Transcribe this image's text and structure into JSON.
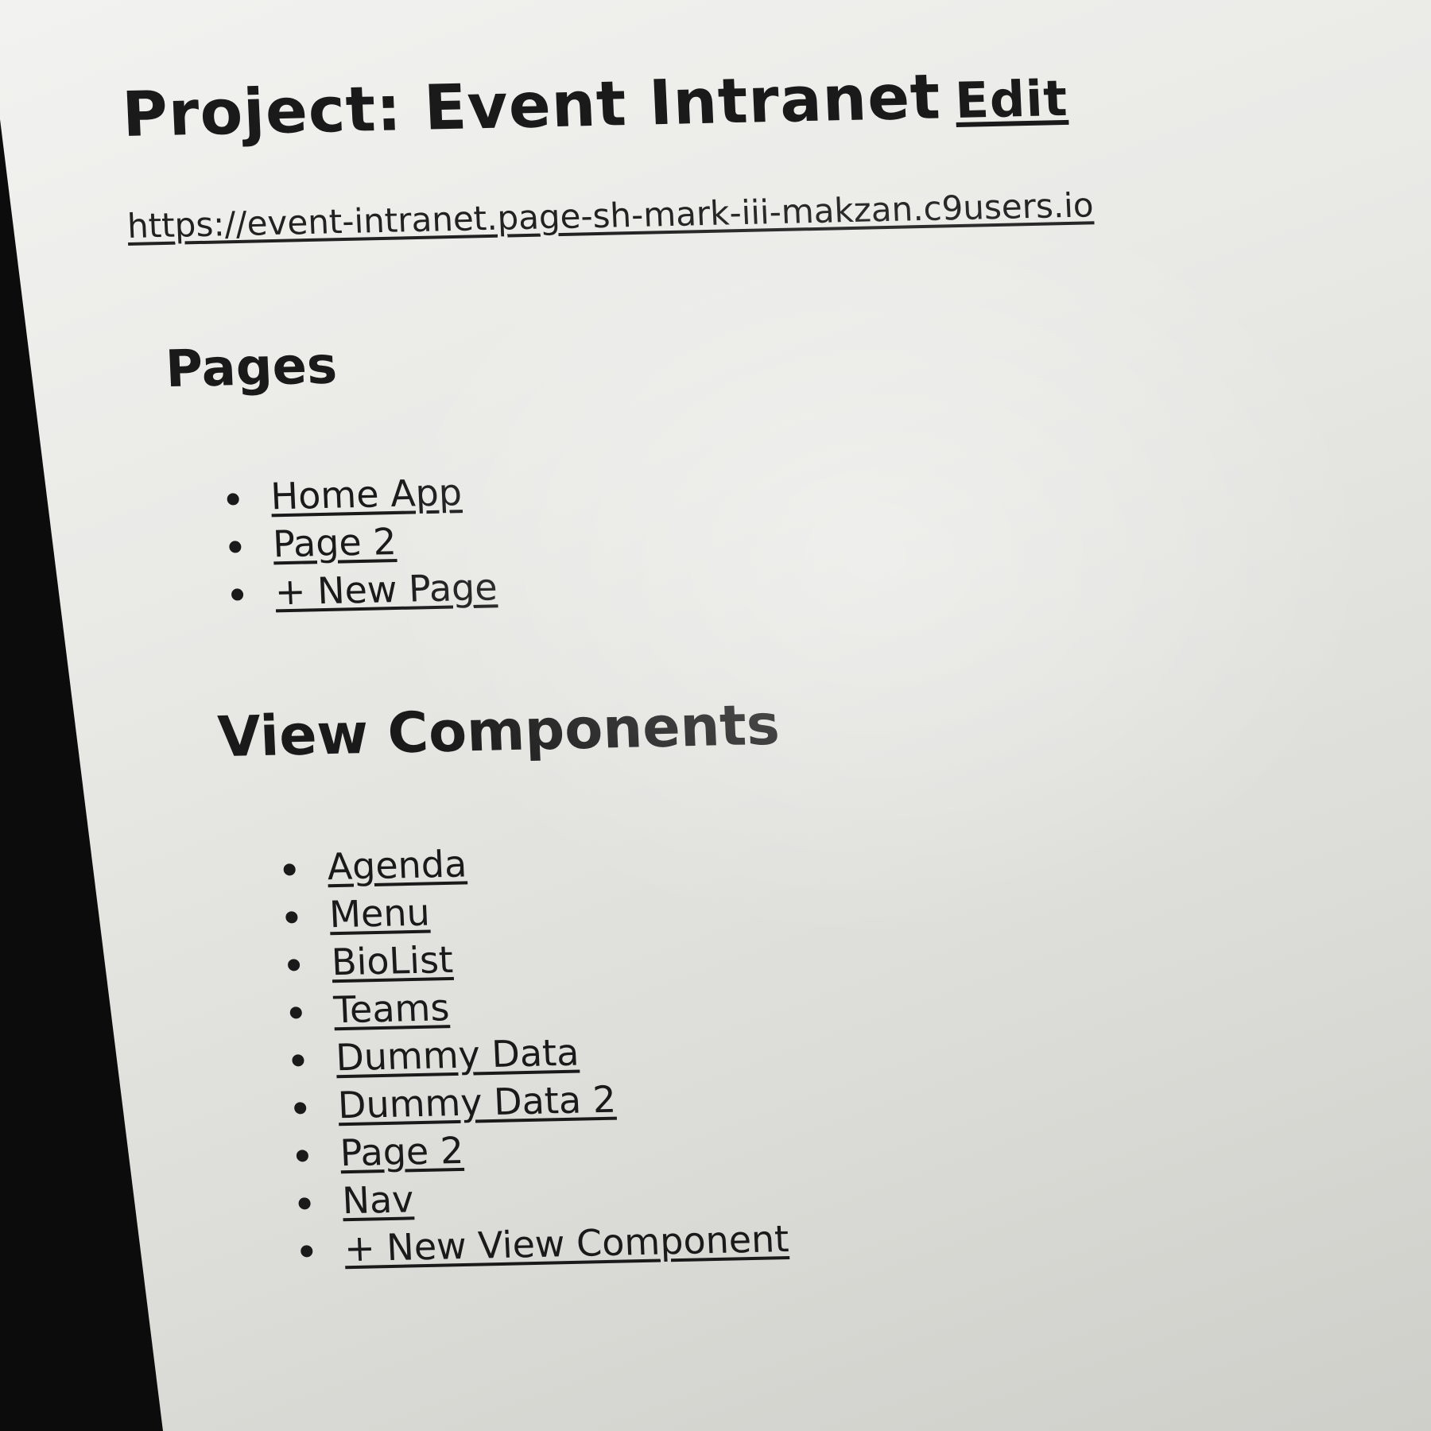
{
  "header": {
    "title": "Project: Event Intranet",
    "edit_label": "Edit"
  },
  "project_url": "https://event-intranet.page-sh-mark-iii-makzan.c9users.io",
  "pages": {
    "heading": "Pages",
    "items": [
      {
        "label": "Home App"
      },
      {
        "label": "Page 2"
      },
      {
        "label": "+ New Page"
      }
    ]
  },
  "view_components": {
    "heading": "View Components",
    "items": [
      {
        "label": "Agenda"
      },
      {
        "label": "Menu"
      },
      {
        "label": "BioList"
      },
      {
        "label": "Teams"
      },
      {
        "label": "Dummy Data"
      },
      {
        "label": "Dummy Data 2"
      },
      {
        "label": "Page 2"
      },
      {
        "label": "Nav"
      },
      {
        "label": "+ New View Component"
      }
    ]
  }
}
